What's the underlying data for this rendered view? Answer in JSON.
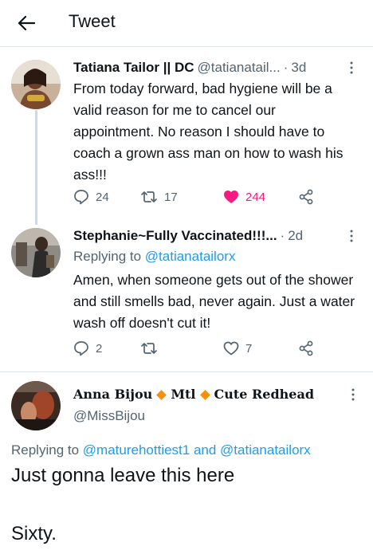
{
  "header": {
    "title": "Tweet"
  },
  "tweets": [
    {
      "name": "Tatiana Tailor || DC",
      "handle": "@tatianatail...",
      "time": "3d",
      "body": "From today forward, bad hygiene will be a valid reason for me to cancel our appointment. No reason I should have to coach a grown ass man on how to wash his ass!!!",
      "replies": "24",
      "retweets": "17",
      "likes": "244"
    },
    {
      "name": "Stephanie~Fully Vaccinated!!!...",
      "time": "2d",
      "replying_label": "Replying to",
      "replying_handle": "@tatianatailorx",
      "body": "Amen, when someone gets out of the shower and still smells bad, never again. Just a water wash off doesn't cut it!",
      "replies": "2",
      "retweets": "",
      "likes": "7"
    }
  ],
  "quoted": {
    "name_part1": "Anna Bijou",
    "name_part2": "Mtl",
    "name_part3": "Cute Redhead",
    "handle": "@MissBijou",
    "replying_label": "Replying to",
    "replying_handles": "@maturehottiest1 and @tatianatailorx",
    "line1": "Just gonna leave this here",
    "line2": "Sixty."
  },
  "colors": {
    "accent": "#1d9bf0",
    "like": "#f91880",
    "secondary": "#536471",
    "diamond": "#f4900c"
  }
}
